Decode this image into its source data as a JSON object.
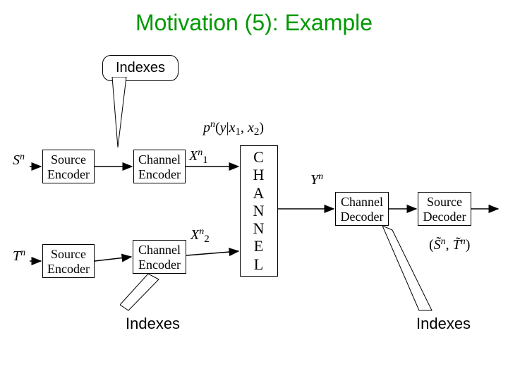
{
  "title": "Motivation (5): Example",
  "callouts": {
    "top": "Indexes",
    "bottom_left": "Indexes",
    "bottom_right": "Indexes"
  },
  "blocks": {
    "source_encoder": "Source\nEncoder",
    "channel_encoder": "Channel\nEncoder",
    "channel": "CHANNEL",
    "channel_decoder": "Channel\nDecoder",
    "source_decoder": "Source\nDecoder"
  },
  "labels": {
    "Sn": "Sⁿ",
    "Tn": "Tⁿ",
    "X1n": "X₁ⁿ",
    "X2n": "X₂ⁿ",
    "Yn": "Yⁿ",
    "out": "(S̃ⁿ, T̃ⁿ)",
    "cond": "pⁿ(y|x₁, x₂)"
  }
}
